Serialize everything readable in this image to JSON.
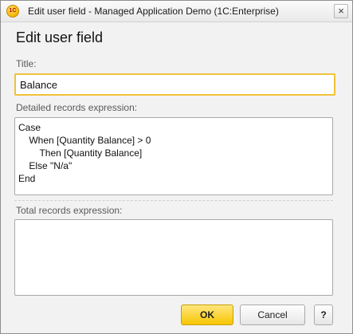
{
  "window": {
    "title": "Edit user field - Managed Application Demo  (1C:Enterprise)",
    "app_icon_text": "1C",
    "close_glyph": "×"
  },
  "form": {
    "heading": "Edit user field",
    "title_label": "Title:",
    "title_value": "Balance",
    "detailed_label": "Detailed records expression:",
    "detailed_value": "Case\n    When [Quantity Balance] > 0\n        Then [Quantity Balance]\n    Else \"N/a\"\nEnd",
    "total_label": "Total records expression:",
    "total_value": ""
  },
  "buttons": {
    "ok": "OK",
    "cancel": "Cancel",
    "help": "?"
  },
  "colors": {
    "accent_border": "#f0c23a",
    "ok_button": "#f7c600"
  }
}
